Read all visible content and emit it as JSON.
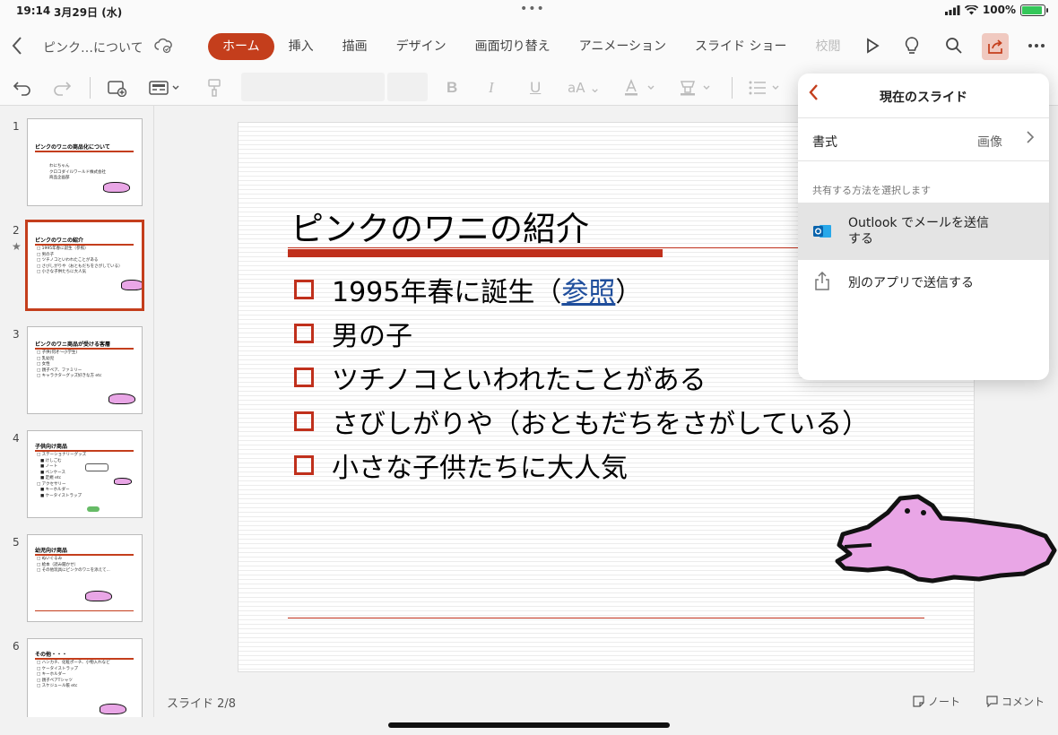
{
  "status": {
    "time": "19:14",
    "date": "3月29日 (水)",
    "dots": "•••",
    "battery": "100%"
  },
  "titlebar": {
    "doc_title": "ピンク…について",
    "tabs": [
      "ホーム",
      "挿入",
      "描画",
      "デザイン",
      "画面切り替え",
      "アニメーション",
      "スライド ショー",
      "校閲"
    ],
    "active_tab": "ホーム"
  },
  "thumbs": [
    {
      "num": "1",
      "title": "ピンクのワニの商品化について",
      "lines": [
        "わにちゃん",
        "クロコダイルワールド株式会社",
        "商品企画部"
      ]
    },
    {
      "num": "2",
      "title": "ピンクのワニの紹介",
      "lines": [
        "□ 1995年春に誕生（参照）",
        "□ 男の子",
        "□ ツチノコといわれたことがある",
        "□ さびしがりや（おともだちをさがしている）",
        "□ 小さな子供たちに大人気"
      ]
    },
    {
      "num": "3",
      "title": "ピンクのワニ商品が受ける客層",
      "lines": [
        "□ 子供(何才〜小学生)",
        "□ 乳幼児",
        "□ 女性",
        "□ 親子ペア、ファミリー",
        "□ キャラクターグッズ好きな方 etc"
      ]
    },
    {
      "num": "4",
      "title": "子供向け商品",
      "lines": [
        "□ ステーショナリーグッズ",
        "■ けしごむ",
        "■ ノート",
        "■ ペンケース",
        "■ 定規 etc",
        "□ アクセサリー",
        "■ キーホルダー",
        "■ ケータイストラップ"
      ]
    },
    {
      "num": "5",
      "title": "幼児向け商品",
      "lines": [
        "□ ぬいぐるみ",
        "□ 絵本（読み聞かせ）",
        "□ その他玩具にピンクのワニを添えて..."
      ]
    },
    {
      "num": "6",
      "title": "その他・・・",
      "lines": [
        "□ ハンカチ、化粧ポーチ、小物入れなど",
        "□ ケータイストラップ",
        "□ キーホルダー",
        "□ 親子ペアTシャツ",
        "□ スケジュール帳 etc"
      ]
    }
  ],
  "slide": {
    "title": "ピンクのワニの紹介",
    "bullets": [
      {
        "pre": "1995年春に誕生（",
        "link": "参照",
        "post": "）"
      },
      {
        "pre": "男の子",
        "link": "",
        "post": ""
      },
      {
        "pre": "ツチノコといわれたことがある",
        "link": "",
        "post": ""
      },
      {
        "pre": "さびしがりや（おともだちをさがしている）",
        "link": "",
        "post": ""
      },
      {
        "pre": "小さな子供たちに大人気",
        "link": "",
        "post": ""
      }
    ]
  },
  "bottom": {
    "slide_count": "スライド 2/8",
    "notes": "ノート",
    "comments": "コメント"
  },
  "popover": {
    "title": "現在のスライド",
    "format_label": "書式",
    "format_value": "画像",
    "section": "共有する方法を選択します",
    "outlook_line1": "Outlook でメールを送信",
    "outlook_line2": "する",
    "other_app": "別のアプリで送信する"
  },
  "colors": {
    "accent": "#c43e1c",
    "croc_pink": "#e9a6e6"
  }
}
